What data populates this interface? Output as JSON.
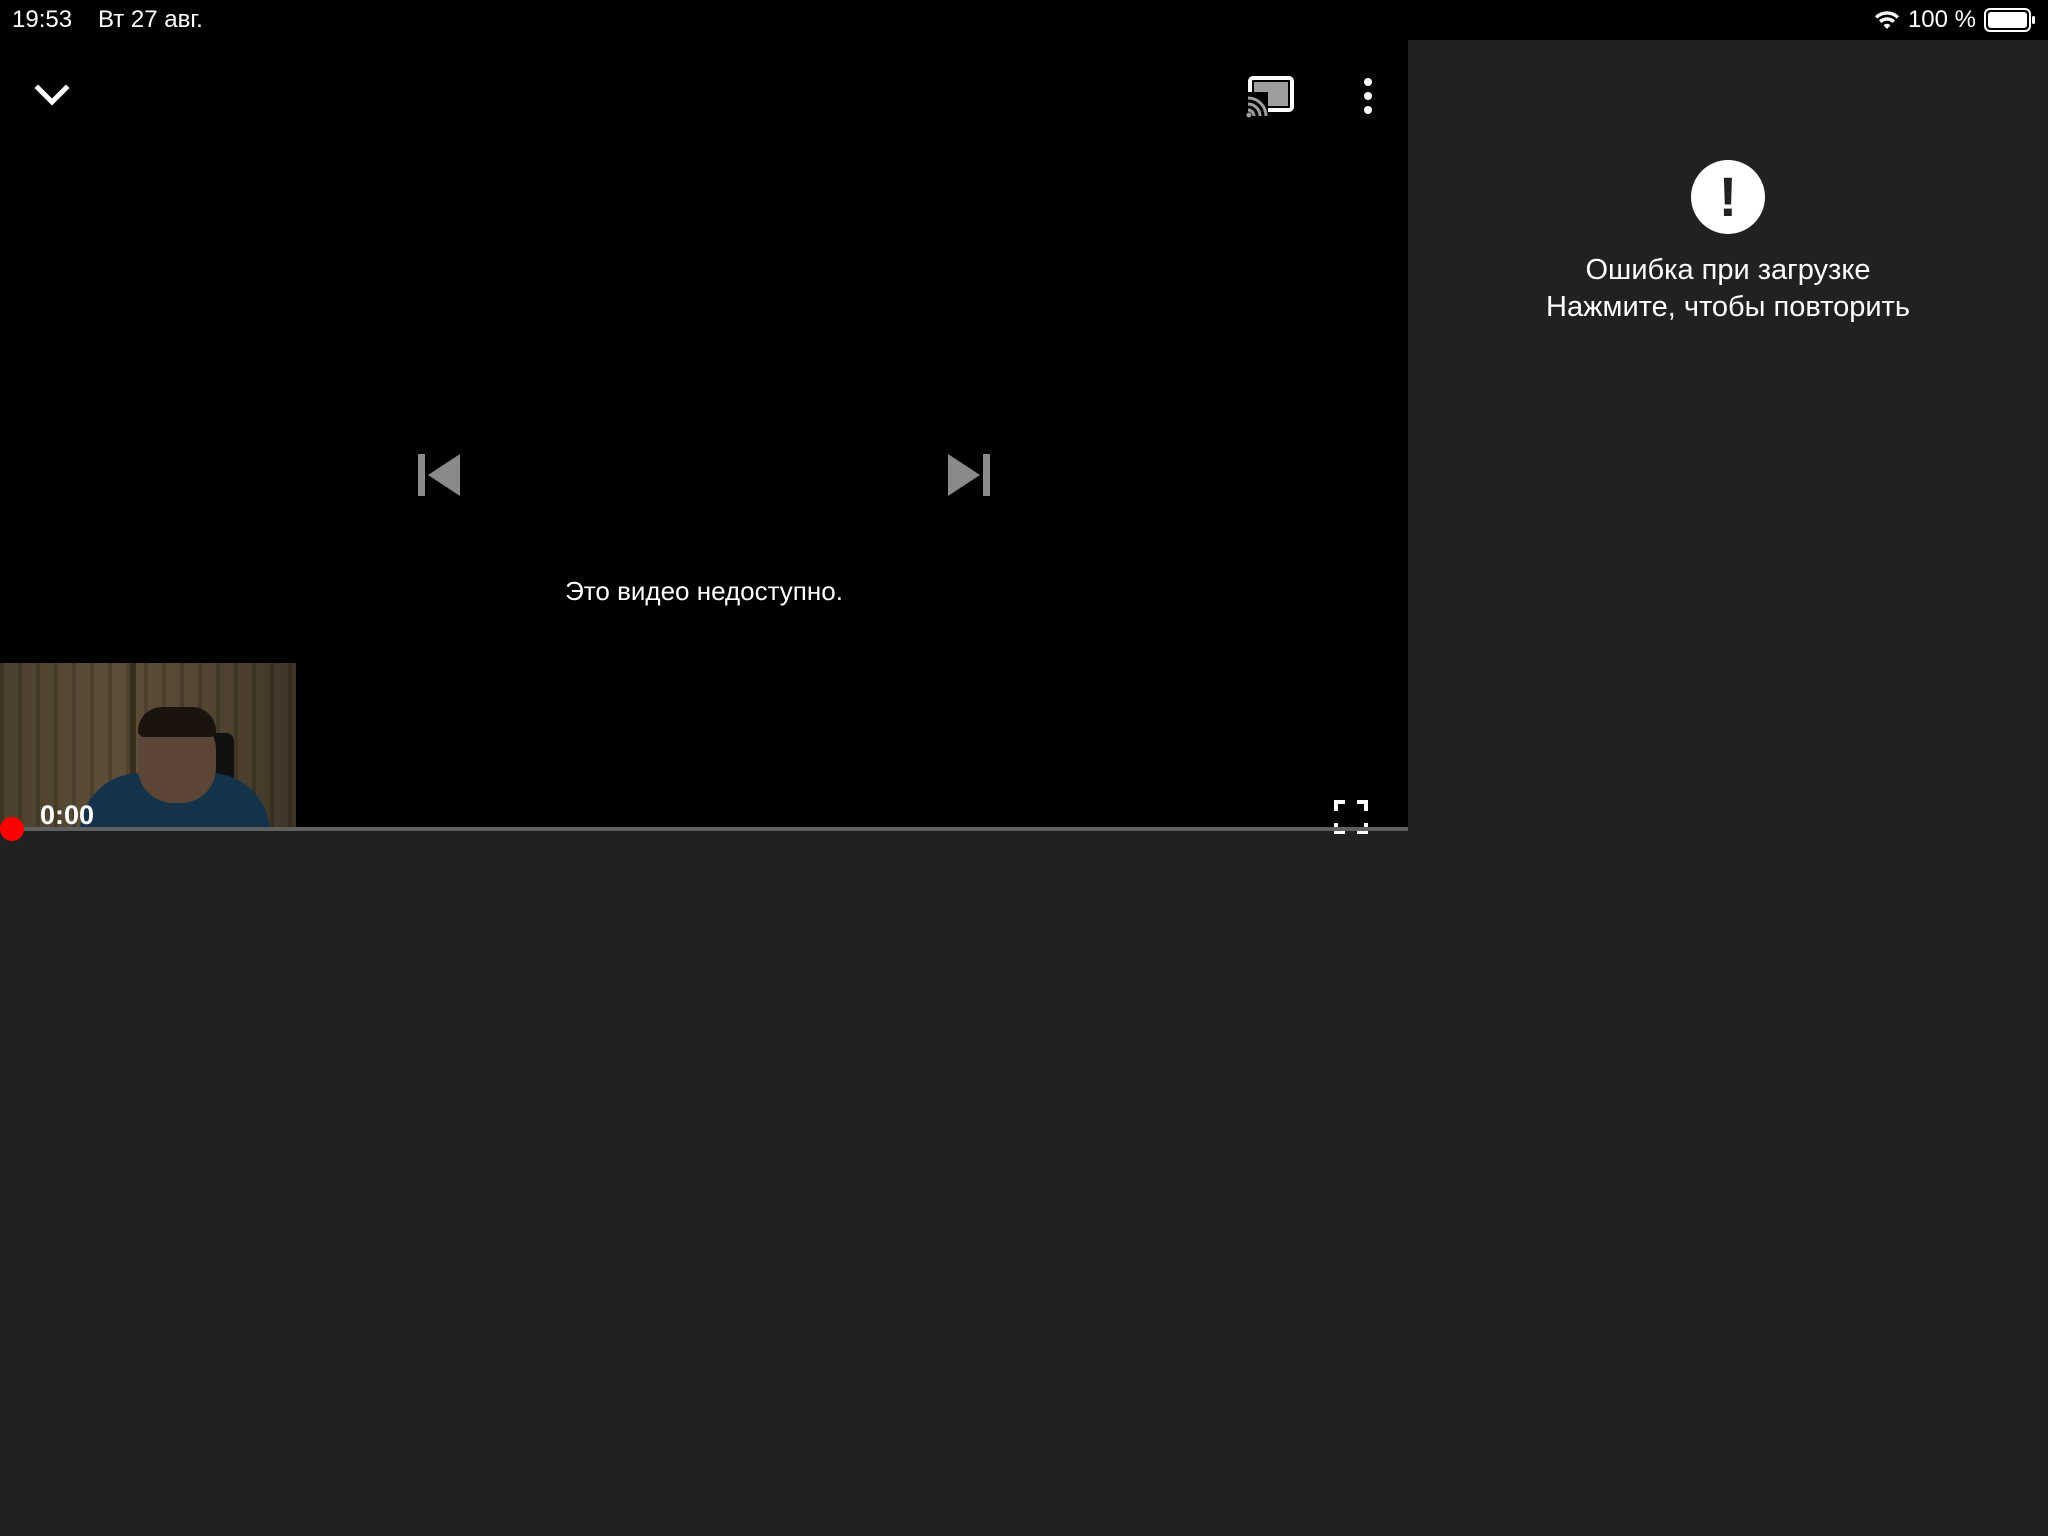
{
  "status_bar": {
    "time": "19:53",
    "date": "Вт 27 авг.",
    "battery_text": "100 %"
  },
  "player": {
    "unavailable_message": "Это видео недоступно.",
    "current_time": "0:00",
    "progress": 0,
    "accent_color": "#ff0000",
    "icons": [
      "chevron-down-icon",
      "cast-icon",
      "more-vert-icon",
      "skip-previous-icon",
      "skip-next-icon",
      "fullscreen-icon"
    ]
  },
  "side_panel": {
    "error_title": "Ошибка при загрузке",
    "error_subtitle": "Нажмите, чтобы повторить",
    "icon": "error-icon"
  }
}
